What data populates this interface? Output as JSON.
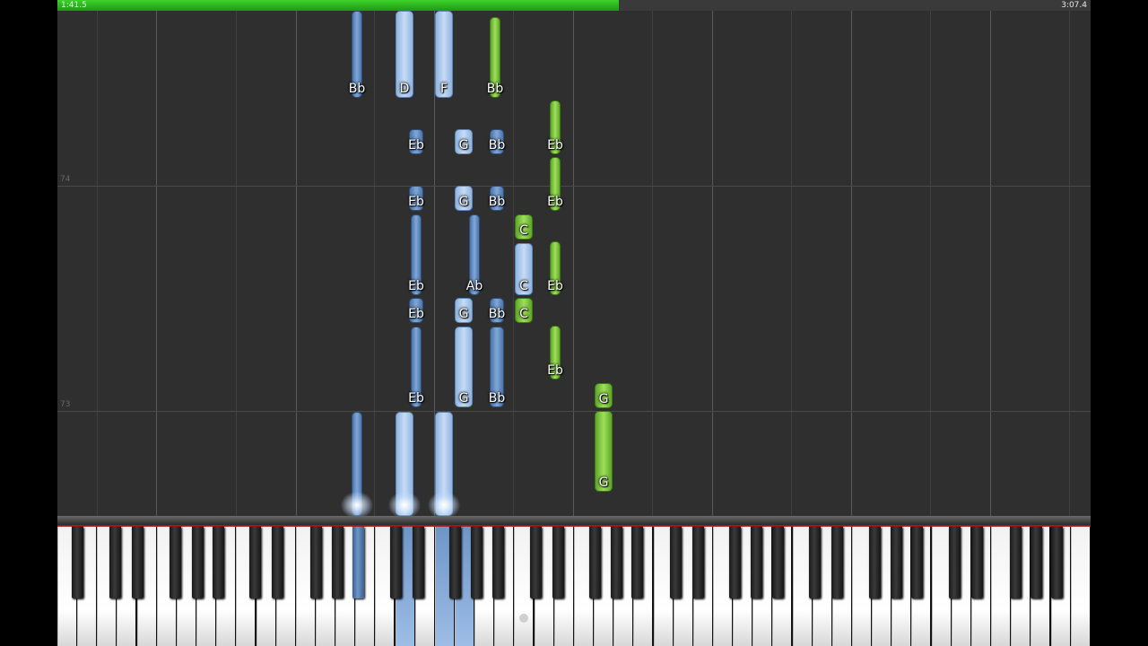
{
  "playback": {
    "current_time": "1:41.5",
    "total_time": "3:07.4",
    "progress_fraction": 0.543
  },
  "measures": [
    "74",
    "73"
  ],
  "colors": {
    "right_hand": "#8fb4e0",
    "left_hand": "#7dc242",
    "progress": "#2db31f"
  },
  "notes": [
    {
      "label": "Bb",
      "hand": "right"
    },
    {
      "label": "D",
      "hand": "right"
    },
    {
      "label": "F",
      "hand": "right"
    },
    {
      "label": "Bb",
      "hand": "left"
    },
    {
      "label": "Eb",
      "hand": "right"
    },
    {
      "label": "G",
      "hand": "right"
    },
    {
      "label": "Bb",
      "hand": "right"
    },
    {
      "label": "Eb",
      "hand": "left"
    },
    {
      "label": "Eb",
      "hand": "right"
    },
    {
      "label": "G",
      "hand": "right"
    },
    {
      "label": "Bb",
      "hand": "right"
    },
    {
      "label": "Eb",
      "hand": "left"
    },
    {
      "label": "C",
      "hand": "left"
    },
    {
      "label": "Eb",
      "hand": "right"
    },
    {
      "label": "Ab",
      "hand": "right"
    },
    {
      "label": "C",
      "hand": "right"
    },
    {
      "label": "Eb",
      "hand": "left"
    },
    {
      "label": "Eb",
      "hand": "right"
    },
    {
      "label": "G",
      "hand": "right"
    },
    {
      "label": "Bb",
      "hand": "right"
    },
    {
      "label": "C",
      "hand": "left"
    },
    {
      "label": "Eb",
      "hand": "left"
    },
    {
      "label": "Eb",
      "hand": "right"
    },
    {
      "label": "G",
      "hand": "right"
    },
    {
      "label": "Bb",
      "hand": "right"
    },
    {
      "label": "G",
      "hand": "left"
    },
    {
      "label": "G",
      "hand": "left"
    },
    {
      "label": "",
      "hand": "right"
    },
    {
      "label": "",
      "hand": "right"
    },
    {
      "label": "",
      "hand": "right"
    }
  ]
}
